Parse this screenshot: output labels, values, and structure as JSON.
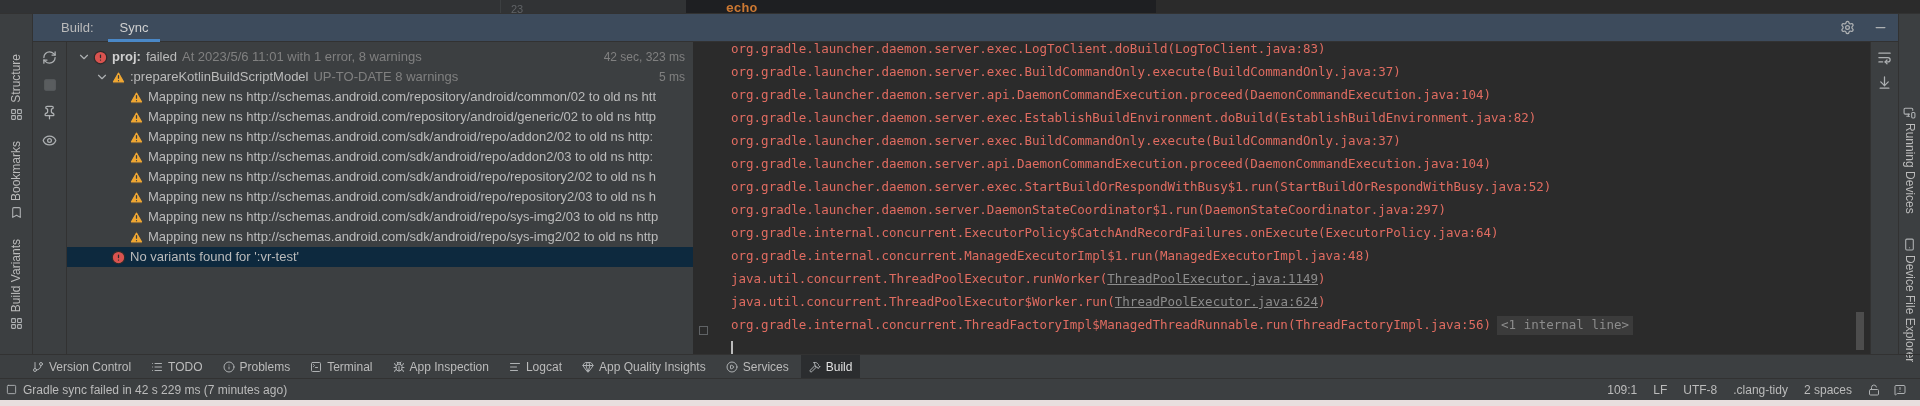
{
  "editor": {
    "line_number": "23",
    "code": "echo"
  },
  "build_header": {
    "title": "Build:",
    "tabs": [
      {
        "label": "Sync",
        "selected": true
      }
    ]
  },
  "left_stripe": [
    "Structure",
    "Bookmarks",
    "Build Variants"
  ],
  "right_stripe": [
    "Running Devices",
    "Device File Explorer"
  ],
  "tree": [
    {
      "kind": "error",
      "expanded": true,
      "selected": false,
      "name": "proj:",
      "label": "failed",
      "detail": "At 2023/5/6 11:01 with 1 error, 8 warnings",
      "time": "42 sec, 323 ms",
      "children": [
        {
          "kind": "warning",
          "expanded": true,
          "selected": false,
          "label": ":prepareKotlinBuildScriptModel",
          "detail": "UP-TO-DATE 8 warnings",
          "time": "5 ms",
          "children": [
            {
              "kind": "warning",
              "selected": false,
              "label": "Mapping new ns http://schemas.android.com/repository/android/common/02 to old ns htt"
            },
            {
              "kind": "warning",
              "selected": false,
              "label": "Mapping new ns http://schemas.android.com/repository/android/generic/02 to old ns http"
            },
            {
              "kind": "warning",
              "selected": false,
              "label": "Mapping new ns http://schemas.android.com/sdk/android/repo/addon2/02 to old ns http:"
            },
            {
              "kind": "warning",
              "selected": false,
              "label": "Mapping new ns http://schemas.android.com/sdk/android/repo/addon2/03 to old ns http:"
            },
            {
              "kind": "warning",
              "selected": false,
              "label": "Mapping new ns http://schemas.android.com/sdk/android/repo/repository2/02 to old ns h"
            },
            {
              "kind": "warning",
              "selected": false,
              "label": "Mapping new ns http://schemas.android.com/sdk/android/repo/repository2/03 to old ns h"
            },
            {
              "kind": "warning",
              "selected": false,
              "label": "Mapping new ns http://schemas.android.com/sdk/android/repo/sys-img2/03 to old ns http"
            },
            {
              "kind": "warning",
              "selected": false,
              "label": "Mapping new ns http://schemas.android.com/sdk/android/repo/sys-img2/02 to old ns http"
            }
          ]
        },
        {
          "kind": "error",
          "selected": true,
          "label": "No variants found for ':vr-test'"
        }
      ]
    }
  ],
  "console": [
    {
      "text": "org.gradle.launcher.daemon.server.exec.LogToClient.doBuild(LogToClient.java:83)"
    },
    {
      "text": "org.gradle.launcher.daemon.server.exec.BuildCommandOnly.execute(BuildCommandOnly.java:37)"
    },
    {
      "text": "org.gradle.launcher.daemon.server.api.DaemonCommandExecution.proceed(DaemonCommandExecution.java:104)"
    },
    {
      "text": "org.gradle.launcher.daemon.server.exec.EstablishBuildEnvironment.doBuild(EstablishBuildEnvironment.java:82)"
    },
    {
      "text": "org.gradle.launcher.daemon.server.exec.BuildCommandOnly.execute(BuildCommandOnly.java:37)"
    },
    {
      "text": "org.gradle.launcher.daemon.server.api.DaemonCommandExecution.proceed(DaemonCommandExecution.java:104)"
    },
    {
      "text": "org.gradle.launcher.daemon.server.exec.StartBuildOrRespondWithBusy$1.run(StartBuildOrRespondWithBusy.java:52)"
    },
    {
      "text": "org.gradle.launcher.daemon.server.DaemonStateCoordinator$1.run(DaemonStateCoordinator.java:297)"
    },
    {
      "text": "org.gradle.internal.concurrent.ExecutorPolicy$CatchAndRecordFailures.onExecute(ExecutorPolicy.java:64)"
    },
    {
      "text": "org.gradle.internal.concurrent.ManagedExecutorImpl$1.run(ManagedExecutorImpl.java:48)"
    },
    {
      "text": "java.util.concurrent.ThreadPoolExecutor.runWorker(",
      "link": "ThreadPoolExecutor.java:1149",
      "after": ")"
    },
    {
      "text": "java.util.concurrent.ThreadPoolExecutor$Worker.run(",
      "link": "ThreadPoolExecutor.java:624",
      "after": ")"
    },
    {
      "text": "org.gradle.internal.concurrent.ThreadFactoryImpl$ManagedThreadRunnable.run(ThreadFactoryImpl.java:56)",
      "folded": "<1 internal line>"
    }
  ],
  "tool_tabs": [
    {
      "label": "Version Control",
      "selected": false
    },
    {
      "label": "TODO",
      "selected": false
    },
    {
      "label": "Problems",
      "selected": false
    },
    {
      "label": "Terminal",
      "selected": false
    },
    {
      "label": "App Inspection",
      "selected": false
    },
    {
      "label": "Logcat",
      "selected": false
    },
    {
      "label": "App Quality Insights",
      "selected": false
    },
    {
      "label": "Services",
      "selected": false
    },
    {
      "label": "Build",
      "selected": true
    }
  ],
  "status_bar": {
    "message": "Gradle sync failed in 42 s 229 ms (7 minutes ago)",
    "items": [
      "109:1",
      "LF",
      "UTF-8",
      ".clang-tidy",
      "2 spaces"
    ]
  }
}
